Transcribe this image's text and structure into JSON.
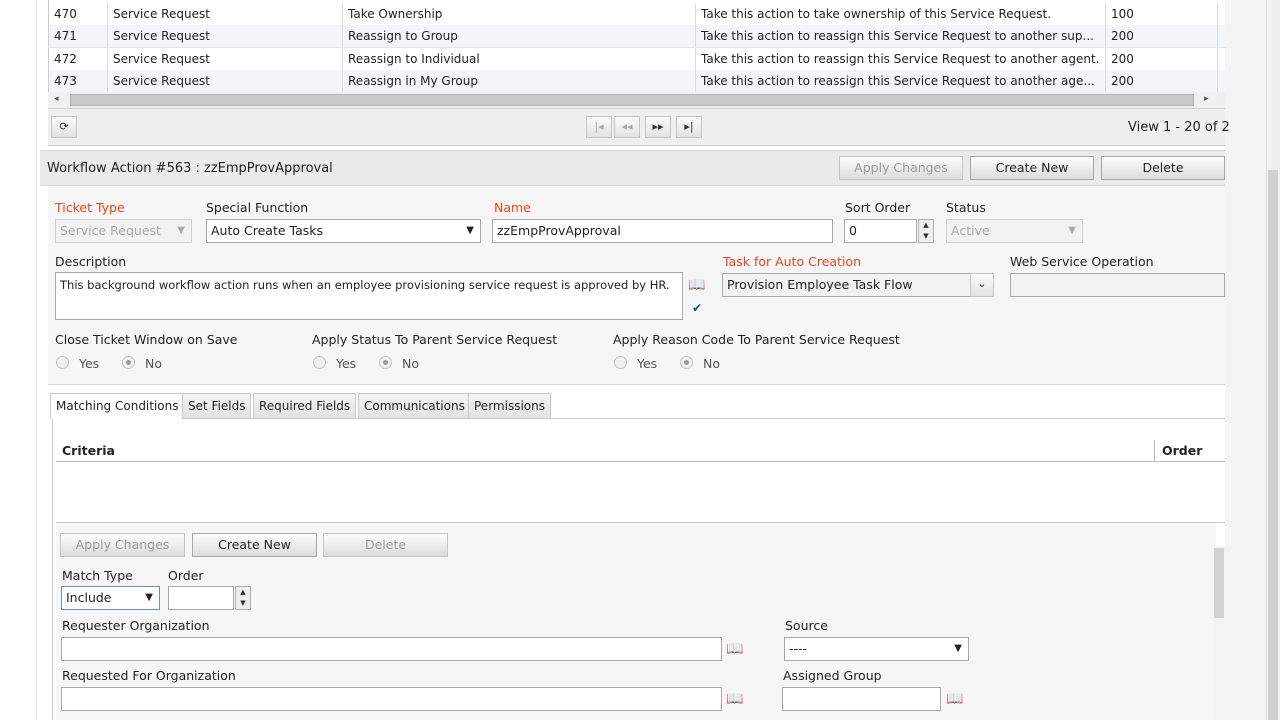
{
  "grid": {
    "rows": [
      {
        "id": "470",
        "type": "Service Request",
        "action": "Take Ownership",
        "desc": "Take this action to take ownership of this Service Request.",
        "order": "100"
      },
      {
        "id": "471",
        "type": "Service Request",
        "action": "Reassign to Group",
        "desc": "Take this action to reassign this Service Request to another sup...",
        "order": "200"
      },
      {
        "id": "472",
        "type": "Service Request",
        "action": "Reassign to Individual",
        "desc": "Take this action to reassign this Service Request to another agent.",
        "order": "200"
      },
      {
        "id": "473",
        "type": "Service Request",
        "action": "Reassign in My Group",
        "desc": "Take this action to reassign this Service Request to another age...",
        "order": "200"
      }
    ],
    "view_text": "View 1 - 20 of 2",
    "pager_buttons": [
      "|◂",
      "◂◂",
      "▸▸",
      "▸|"
    ]
  },
  "header": {
    "title": "Workflow Action #563 : zzEmpProvApproval",
    "apply_changes": "Apply Changes",
    "create_new": "Create New",
    "delete": "Delete"
  },
  "form": {
    "ticket_type_label": "Ticket Type",
    "ticket_type_value": "Service Request",
    "special_function_label": "Special Function",
    "special_function_value": "Auto Create Tasks",
    "name_label": "Name",
    "name_value": "zzEmpProvApproval",
    "sort_order_label": "Sort Order",
    "sort_order_value": "0",
    "status_label": "Status",
    "status_value": "Active",
    "description_label": "Description",
    "description_value": "This background workflow action runs when an employee provisioning service request is approved by HR.",
    "task_label": "Task for Auto Creation",
    "task_value": "Provision Employee Task Flow",
    "web_service_label": "Web Service Operation",
    "close_ticket_label": "Close Ticket Window on Save",
    "apply_status_label": "Apply Status To Parent Service Request",
    "apply_reason_label": "Apply Reason Code To Parent Service Request",
    "yes": "Yes",
    "no": "No"
  },
  "tabs": [
    "Matching Conditions",
    "Set Fields",
    "Required Fields",
    "Communications",
    "Permissions"
  ],
  "criteria": {
    "col_criteria": "Criteria",
    "col_order": "Order"
  },
  "subform": {
    "apply_changes": "Apply Changes",
    "create_new": "Create New",
    "delete": "Delete",
    "match_type_label": "Match Type",
    "match_type_value": "Include",
    "order_label": "Order",
    "requester_org_label": "Requester Organization",
    "source_label": "Source",
    "source_value": "----",
    "requested_for_org_label": "Requested For Organization",
    "assigned_group_label": "Assigned Group"
  }
}
